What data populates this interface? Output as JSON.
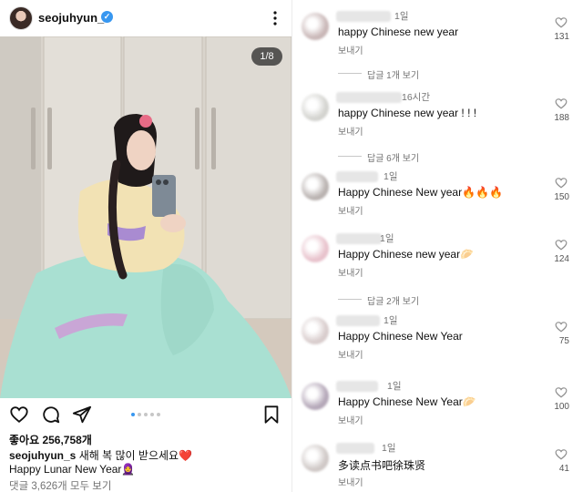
{
  "post": {
    "username": "seojuhyun_s",
    "image_counter": "1/8",
    "likes": "좋아요 256,758개",
    "caption_user": "seojuhyun_s",
    "caption_text": "새해 복 많이 받으세요❤️",
    "caption_line2": "Happy Lunar New Year🧕",
    "view_comments": "댓글 3,626개 모두 보기",
    "carousel_total": 5,
    "carousel_active": 0
  },
  "comments": {
    "reply_label": "보내기",
    "items": [
      {
        "time": "1일",
        "text": "happy Chinese new year",
        "likes": "131",
        "avatar_color": "#c9b7b7"
      },
      {
        "time": "16시간",
        "text": "happy Chinese new year ! ! !",
        "likes": "188",
        "avatar_color": "#d3d3cf"
      },
      {
        "time": "1일",
        "text": "Happy Chinese New year🔥🔥🔥",
        "likes": "150",
        "avatar_color": "#b9b2b0"
      },
      {
        "time": "1일",
        "text": "Happy Chinese new year🥟",
        "likes": "124",
        "avatar_color": "#e8c2cc"
      },
      {
        "time": "1일",
        "text": "Happy Chinese New Year",
        "likes": "75",
        "avatar_color": "#d8cccc"
      },
      {
        "time": "1일",
        "text": "Happy Chinese New Year🥟",
        "likes": "100",
        "avatar_color": "#b4a7b8"
      },
      {
        "time": "1일",
        "text": "多读点书吧徐珠贤",
        "likes": "41",
        "avatar_color": "#cfc8c6"
      }
    ],
    "threads": [
      {
        "text": "답글 1개 보기"
      },
      {
        "text": "답글 6개 보기"
      },
      {
        "text": "답글 2개 보기"
      }
    ]
  }
}
